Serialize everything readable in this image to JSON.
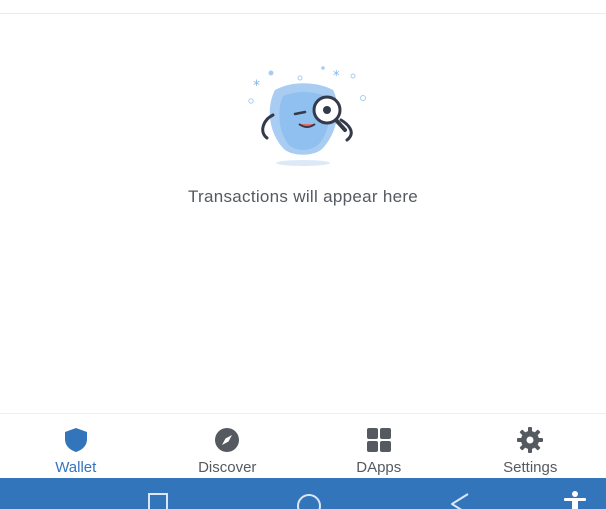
{
  "empty_state": {
    "message": "Transactions will appear here",
    "illustration_icon": "mascot-with-magnifier-icon"
  },
  "bottom_nav": {
    "active": "Wallet",
    "items": [
      {
        "label": "Wallet",
        "icon": "shield-icon"
      },
      {
        "label": "Discover",
        "icon": "compass-icon"
      },
      {
        "label": "DApps",
        "icon": "grid-icon"
      },
      {
        "label": "Settings",
        "icon": "gear-icon"
      }
    ]
  },
  "system_bar": {
    "buttons": [
      "recent-apps-icon",
      "home-icon",
      "back-icon",
      "accessibility-icon"
    ]
  },
  "colors": {
    "accent": "#3375bb",
    "icon_gray": "#555a60",
    "mascot_light": "#a9cdf2",
    "mascot_main": "#7fb6ec"
  }
}
